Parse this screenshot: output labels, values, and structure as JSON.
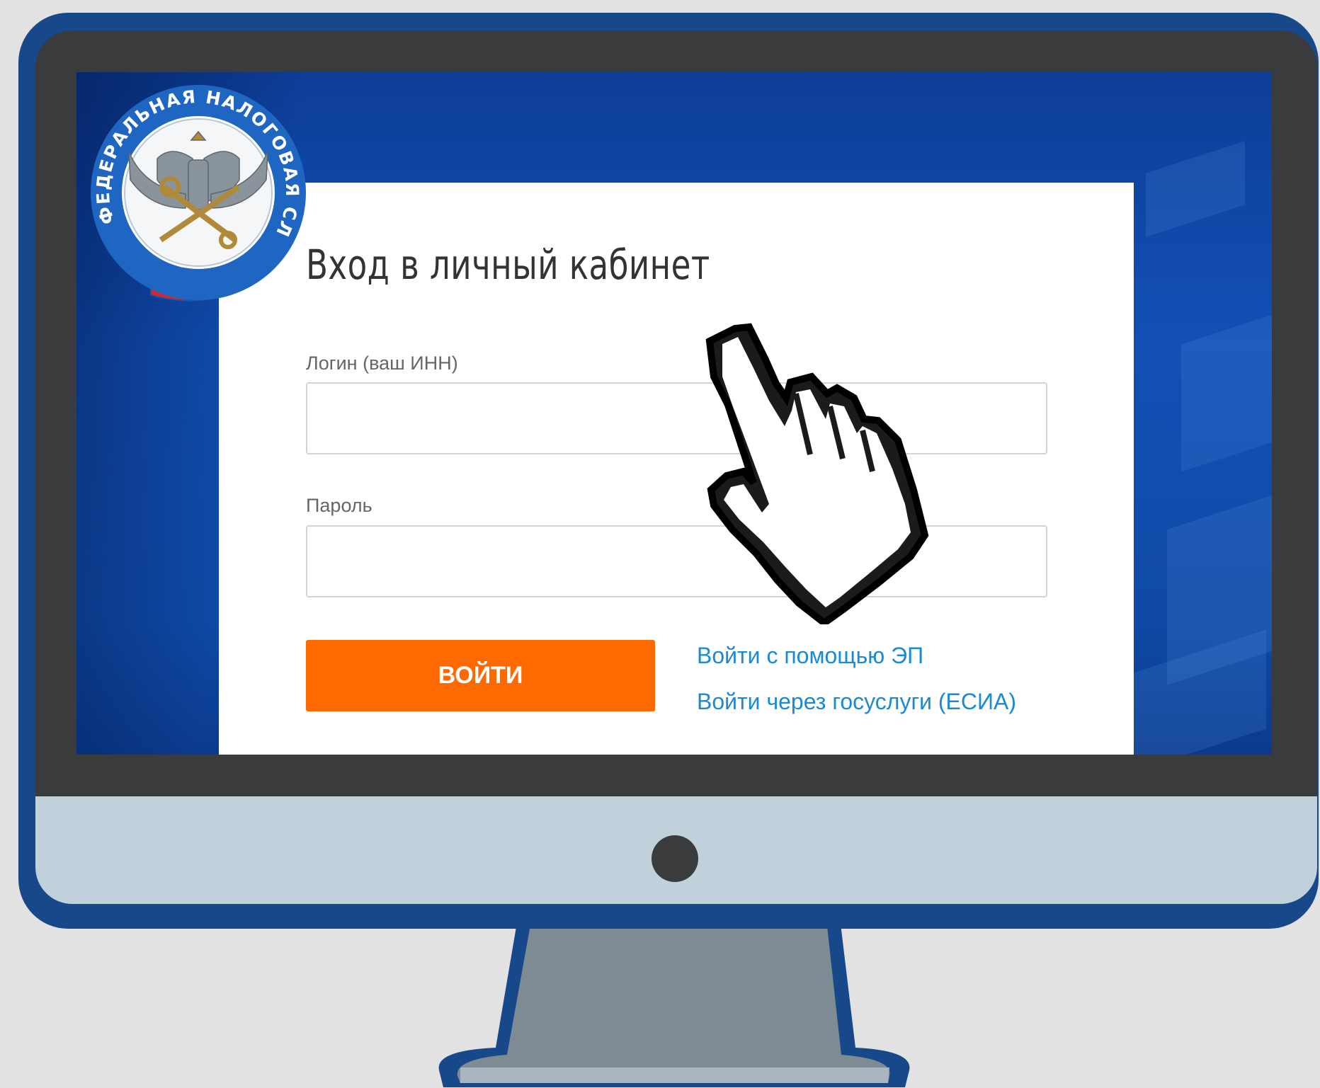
{
  "emblem": {
    "top_text": "ФЕДЕРАЛЬНАЯ НАЛОГОВАЯ СЛУЖБА",
    "icon": "fns-emblem-icon"
  },
  "login": {
    "title": "Вход в личный кабинет",
    "login_label": "Логин (ваш ИНН)",
    "login_value": "",
    "password_label": "Пароль",
    "password_value": "",
    "submit_label": "ВОЙТИ",
    "link_ep": "Войти с помощью ЭП",
    "link_esia": "Войти через госуслуги (ЕСИА)"
  },
  "colors": {
    "accent_button": "#ff6a00",
    "link": "#1a8ad4",
    "screen_bg": "#1250b5",
    "monitor_frame": "#17488a"
  },
  "cursor_icon": "pointing-hand-cursor-icon"
}
